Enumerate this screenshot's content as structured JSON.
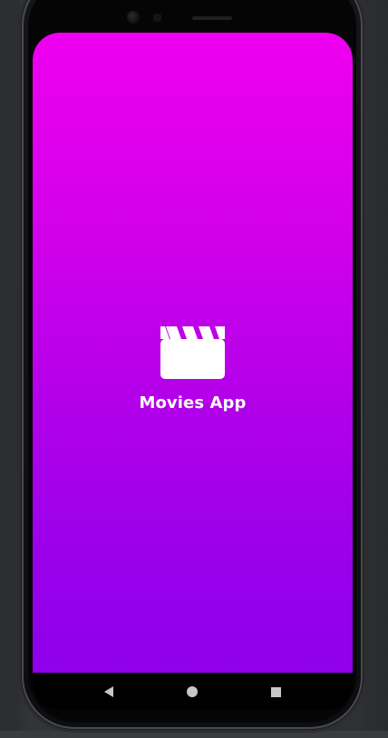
{
  "app": {
    "title": "Movies App",
    "icon": "clapperboard-icon",
    "background": {
      "top": "#ee00ef",
      "bottom": "#8f00eb"
    }
  },
  "device": {
    "accent": "#d0653a"
  },
  "system_nav": {
    "back_icon": "back-triangle-icon",
    "home_icon": "home-circle-icon",
    "recent_icon": "recent-square-icon"
  }
}
